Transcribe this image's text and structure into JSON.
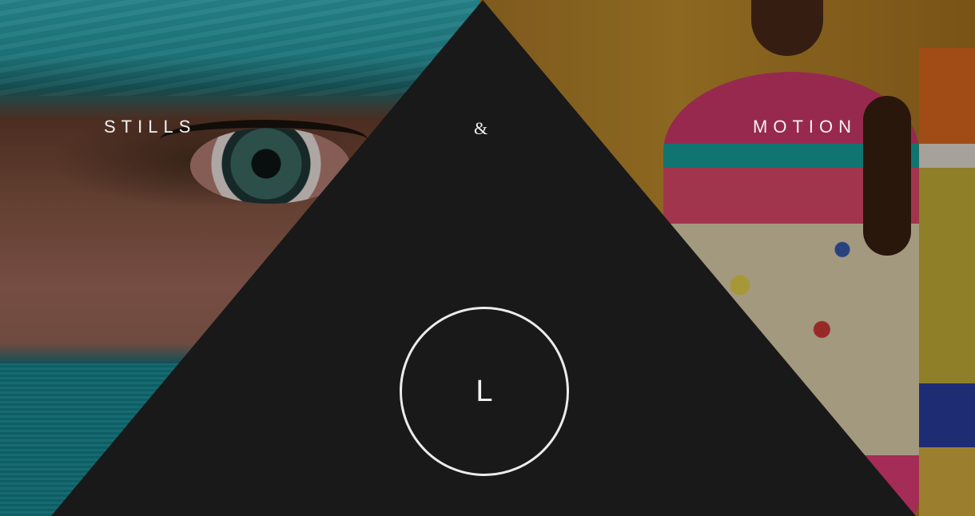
{
  "nav": {
    "stills_label": "STILLS",
    "separator": "&",
    "motion_label": "MOTION"
  },
  "logo": {
    "letter": "L"
  },
  "colors": {
    "triangle": "#191919",
    "text": "#f2f2f2",
    "circle_border": "#ececec"
  }
}
